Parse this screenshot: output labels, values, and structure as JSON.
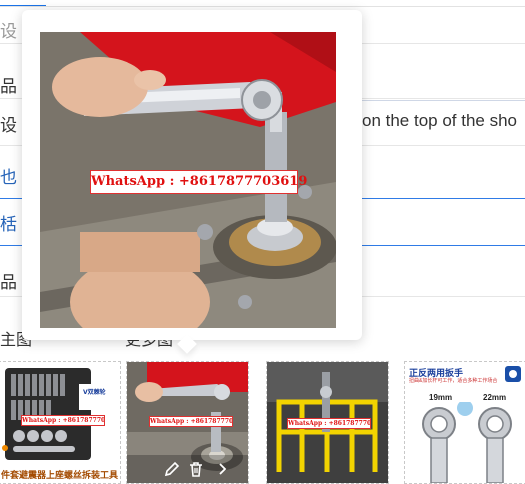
{
  "form": {
    "tab_label": "",
    "rows": [
      {
        "label": "设",
        "style": "grey"
      },
      {
        "label": "品",
        "style": "normal"
      },
      {
        "label": "设",
        "style": "normal"
      },
      {
        "label": "也",
        "style": "blue"
      },
      {
        "label": "栝",
        "style": "blue"
      },
      {
        "label": "品",
        "style": "normal"
      }
    ],
    "field_value": "on the top of the sho"
  },
  "popover": {
    "image_alt": "ratchet wrench on car strut mount",
    "whatsapp_text": "WhatsApp : +8617877703619"
  },
  "media": {
    "main_label": "主图",
    "more_label": "更多图",
    "thumbnails": [
      {
        "caption": "件套避震器上座螺丝拆装工具",
        "whatsapp": "WhatsApp : +8617877703619",
        "badge": "V双棘轮"
      },
      {
        "caption": "",
        "whatsapp": "WhatsApp : +8617877703619"
      },
      {
        "caption": "",
        "whatsapp": "WhatsApp : +8617877703619"
      },
      {
        "title": "正反两用扳手",
        "subtitle": "扭曲&加长杆可工作，适合多种工作场合",
        "size_a": "19mm",
        "size_b": "22mm"
      }
    ],
    "edit_icon": "pencil-icon",
    "delete_icon": "trash-icon",
    "next_icon": "chevron-right-icon"
  },
  "colors": {
    "accent": "#2f7be6",
    "whatsapp_red": "#e01010",
    "car_red": "#d4141c"
  }
}
